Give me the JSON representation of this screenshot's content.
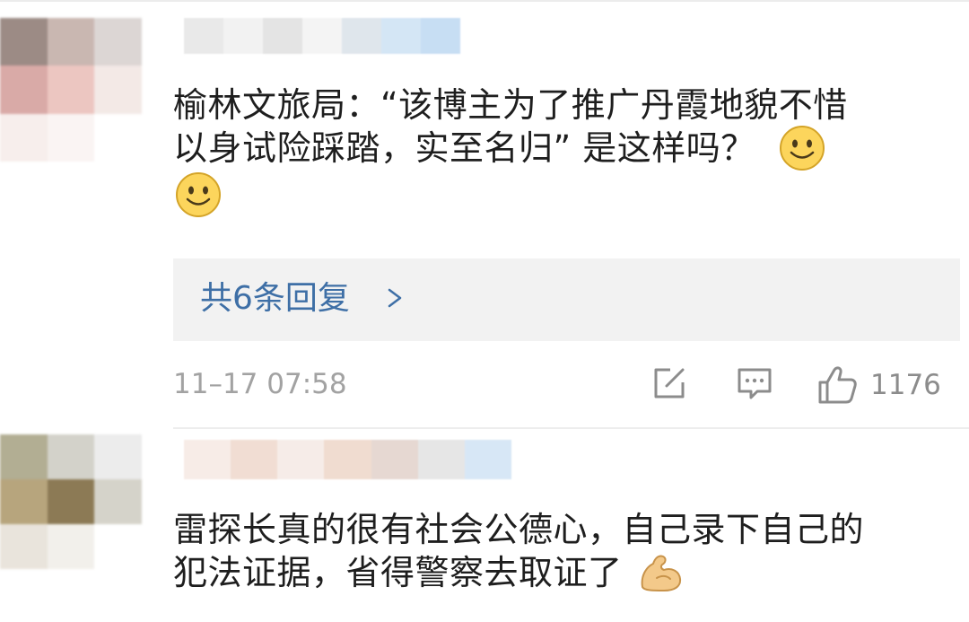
{
  "comments": [
    {
      "lines": [
        "榆林文旅局：“该博主为了推广丹霞地貌不惜",
        "以身试险踩踏，实至名归”  是这样吗？"
      ],
      "emoji": [
        "smiley-face-emoji",
        "smiley-face-emoji"
      ],
      "replies_label": "共6条回复",
      "timestamp": "11–17 07:58",
      "likes": "1176",
      "avatar_colors": [
        "#9c8b85",
        "#c9b7b1",
        "#dcd6d4",
        "#d9aaa7",
        "#ecc6c1",
        "#f3e9e6",
        "#f7eeec",
        "#faf4f3",
        "#ffffff"
      ],
      "name_colors": [
        "#e9e9e9",
        "#f2f2f2",
        "#e4e4e4",
        "#f4f4f4",
        "#dfe6ec",
        "#d4e6f5",
        "#c7def3"
      ]
    },
    {
      "lines": [
        "雷探长真的很有社会公德心，自己录下自己的",
        "犯法证据，省得警察去取证了"
      ],
      "emoji": [
        "flexed-biceps-emoji"
      ],
      "avatar_colors": [
        "#b2ae93",
        "#d3d2ca",
        "#ececec",
        "#b7a57d",
        "#8c7a55",
        "#d5d3ca",
        "#e9e4dc",
        "#f2f0eb",
        "#ffffff"
      ],
      "name_colors": [
        "#f7ece7",
        "#f1ddd3",
        "#f6ece8",
        "#f0dcd0",
        "#e6d8d2",
        "#e6e6e6",
        "#d7e7f6"
      ]
    }
  ]
}
